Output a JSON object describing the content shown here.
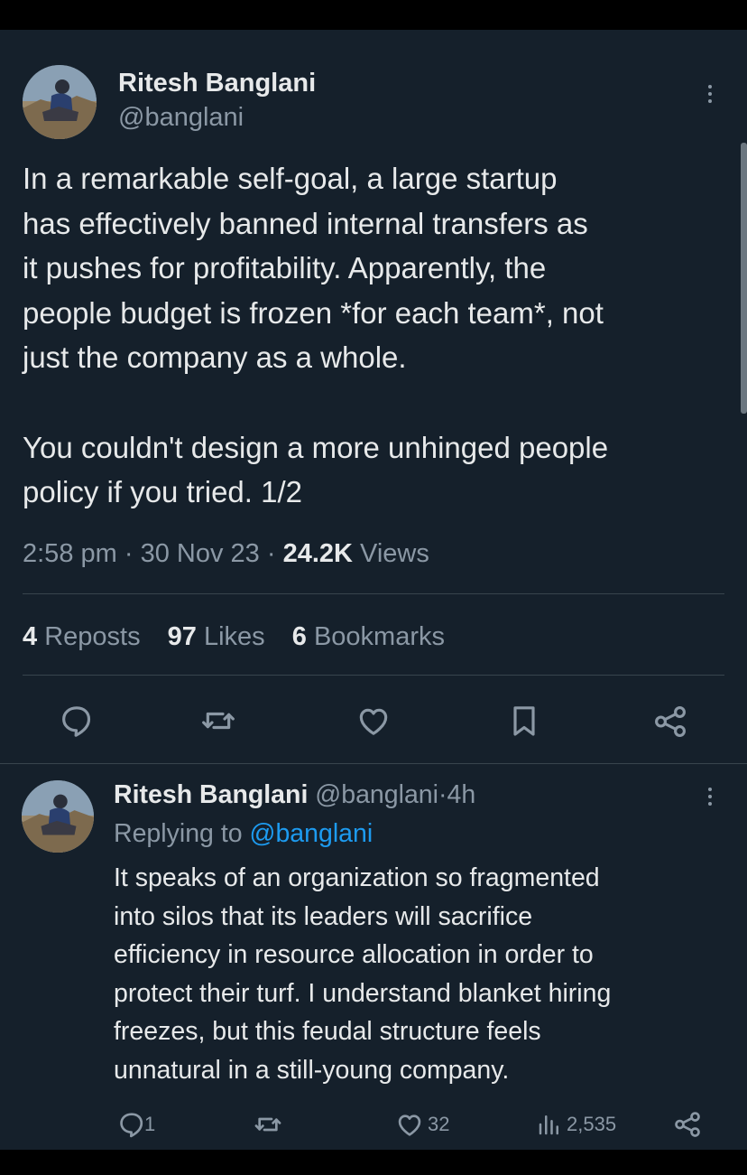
{
  "tweet": {
    "author_name": "Ritesh Banglani",
    "author_handle": "@banglani",
    "text_lines": [
      "In a remarkable self-goal, a large startup",
      "has effectively banned internal transfers as",
      "it pushes for profitability. Apparently, the",
      "people budget is frozen *for each team*, not",
      "just the company as a whole."
    ],
    "text_lines_2": [
      "You couldn't design a more unhinged people",
      "policy if you tried. 1/2"
    ],
    "time": "2:58 pm",
    "separator": "·",
    "date": "30 Nov 23",
    "views_count": "24.2K",
    "views_label": "Views",
    "reposts_count": "4",
    "reposts_label": "Reposts",
    "likes_count": "97",
    "likes_label": "Likes",
    "bookmarks_count": "6",
    "bookmarks_label": "Bookmarks"
  },
  "reply": {
    "author_name": "Ritesh Banglani",
    "author_handle": "@banglani",
    "separator": "·",
    "age": "4h",
    "replying_prefix": "Replying to",
    "replying_handle": "@banglani",
    "text_lines": [
      "It speaks of an organization so fragmented",
      "into silos that its leaders will sacrifice",
      "efficiency in resource allocation in order to",
      "protect their turf. I understand blanket hiring",
      "freezes, but this feudal structure feels",
      "unnatural in a still-young company."
    ],
    "replies_count": "1",
    "likes_count": "32",
    "views_count": "2,535"
  },
  "icons": {
    "reply": "reply-icon",
    "repost": "repost-icon",
    "like": "heart-icon",
    "bookmark": "bookmark-icon",
    "share": "share-icon",
    "views": "views-icon",
    "more": "more-icon"
  },
  "colors": {
    "background": "#15202b",
    "text": "#e7e9ea",
    "muted": "#8b98a5",
    "link": "#1d9bf0",
    "divider": "#38444d"
  }
}
